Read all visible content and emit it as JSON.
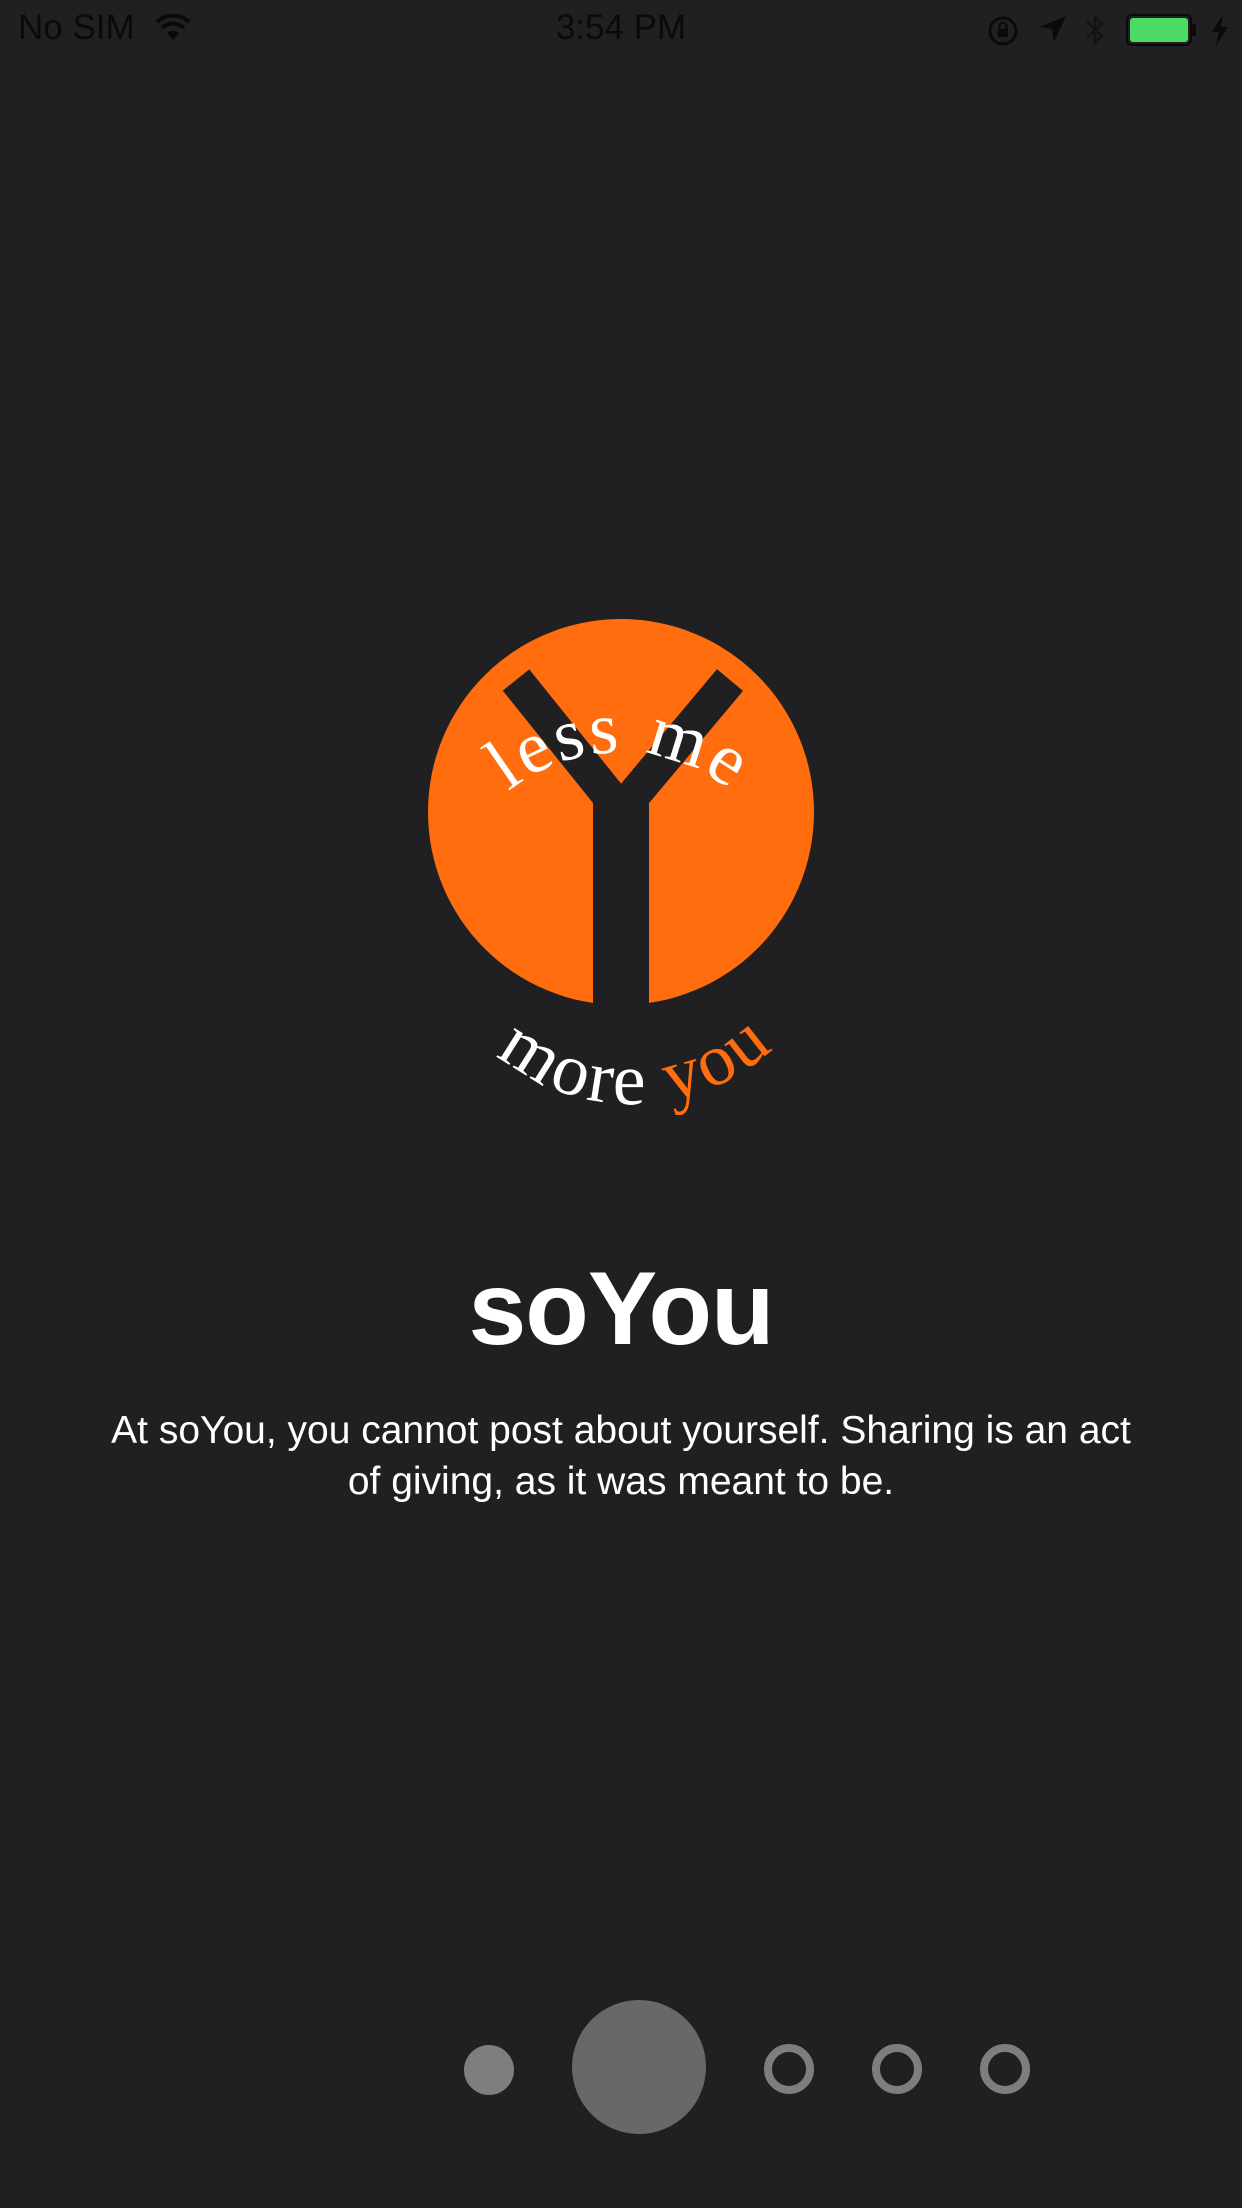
{
  "status_bar": {
    "carrier": "No SIM",
    "time": "3:54 PM",
    "wifi_icon": "wifi-icon",
    "rotation_lock_icon": "rotation-lock-icon",
    "location_icon": "location-arrow-icon",
    "bluetooth_icon": "bluetooth-icon",
    "battery_icon": "battery-full-icon",
    "charging_icon": "charging-bolt-icon",
    "battery_color": "#4cd964"
  },
  "logo": {
    "top_text": "less me",
    "bottom_text_white": "more",
    "bottom_text_orange": "you",
    "accent_color": "#ff6d0f"
  },
  "onboarding": {
    "title": "soYou",
    "description": "At soYou, you cannot post about yourself.  Sharing is an act of giving, as it was meant to be."
  },
  "page_indicator": {
    "page_count": 5,
    "current_page": 2,
    "dot_color": "#7e7e80",
    "active_dot_color": "#68686a"
  },
  "colors": {
    "background": "#202022",
    "text": "#ffffff",
    "accent": "#ff6d0f"
  }
}
